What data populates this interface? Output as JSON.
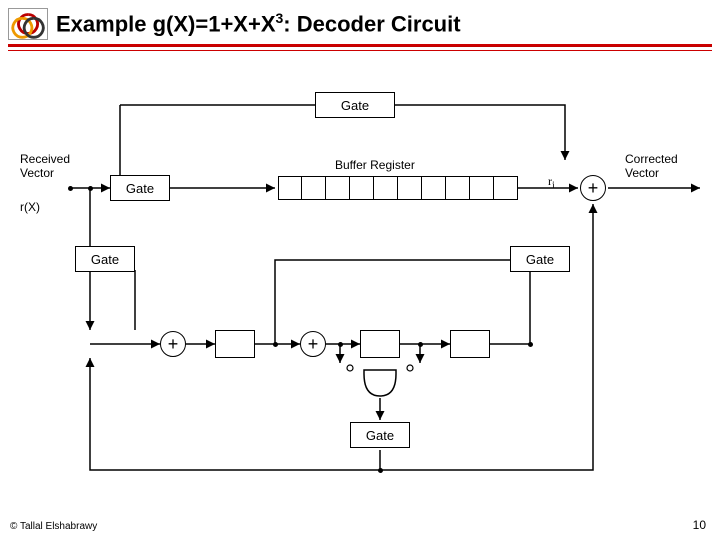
{
  "header": {
    "title_pre": "Example g(X)=1+X+X",
    "title_exp": "3",
    "title_post": ": Decoder Circuit"
  },
  "labels": {
    "gate_top": "Gate",
    "received_vector_l1": "Received",
    "received_vector_l2": "Vector",
    "rx": "r(X)",
    "gate_left": "Gate",
    "buffer": "Buffer Register",
    "ri": "r",
    "ri_sub": "i",
    "corrected_l1": "Corrected",
    "corrected_l2": "Vector",
    "gate_mid_left": "Gate",
    "gate_mid_right": "Gate",
    "gate_bottom": "Gate",
    "plus": "+"
  },
  "footer": {
    "copyright": "© Tallal Elshabrawy",
    "page": "10"
  }
}
